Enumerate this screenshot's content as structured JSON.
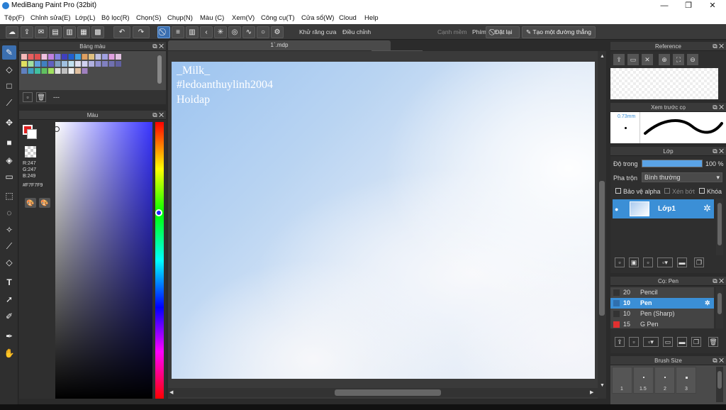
{
  "window": {
    "title": "MediBang Paint Pro (32bit)",
    "minimize": "—",
    "maximize": "❐",
    "close": "✕"
  },
  "menu": [
    "Tệp(F)",
    "Chỉnh sửa(E)",
    "Lớp(L)",
    "Bộ lọc(R)",
    "Chọn(S)",
    "Chụp(N)",
    "Màu (C)",
    "Xem(V)",
    "Công cụ(T)",
    "Cửa sổ(W)",
    "Cloud",
    "Help"
  ],
  "toolbar": {
    "antialias": "Khử răng cưa",
    "correction_label": "Điều chỉnh",
    "correction_value": "0",
    "soft_edge": "Cạnh mềm",
    "key_label": "Phím",
    "reset": "Đặt lại",
    "straight_line": "Tạo một đường thẳng"
  },
  "palette": {
    "title": "Bảng màu",
    "more": "---"
  },
  "color": {
    "title": "Màu",
    "r": "R:247",
    "g": "G:247",
    "b": "B:249",
    "hex": "#F7F7F9"
  },
  "document": {
    "tab": "1`.mdp",
    "lines": [
      "_Milk_",
      "#ledoanthuylinh2004",
      "Hoidap"
    ]
  },
  "reference": {
    "title": "Reference"
  },
  "brush_preview": {
    "title": "Xem trước cọ",
    "size": "0.73mm"
  },
  "layer": {
    "title": "Lớp",
    "opacity_label": "Độ trong",
    "opacity_value": "100 %",
    "blend_label": "Pha trộn",
    "blend_value": "Bình thường",
    "protect_alpha": "Bảo vệ alpha",
    "clipping": "Xén bớt",
    "lock": "Khóa",
    "layer_name": "Lớp1"
  },
  "brushes": {
    "title": "Cọ: Pen",
    "items": [
      {
        "size": "20",
        "name": "Pencil",
        "color": "#333333"
      },
      {
        "size": "10",
        "name": "Pen",
        "color": "#2f6fae"
      },
      {
        "size": "10",
        "name": "Pen (Sharp)",
        "color": "#333333"
      },
      {
        "size": "15",
        "name": "G Pen",
        "color": "#e03030"
      }
    ]
  },
  "brush_size": {
    "title": "Brush Size",
    "labels": [
      "1",
      "1.5",
      "2",
      "3"
    ]
  },
  "colors": {
    "accent": "#3b6fb0",
    "panel": "#2f2f2f",
    "selected_row": "#3b8fd6"
  }
}
